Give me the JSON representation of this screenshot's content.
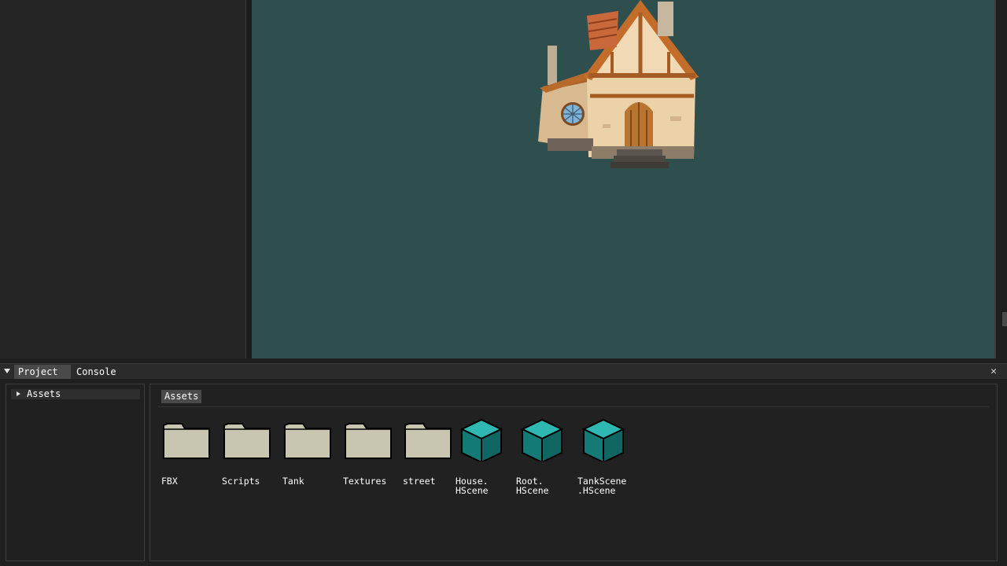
{
  "panel": {
    "tabs": [
      {
        "label": "Project",
        "active": true
      },
      {
        "label": "Console",
        "active": false
      }
    ],
    "close_glyph": "✕"
  },
  "tree": {
    "root_label": "Assets"
  },
  "browser": {
    "breadcrumb": "Assets",
    "items": [
      {
        "label": "FBX",
        "kind": "folder"
      },
      {
        "label": "Scripts",
        "kind": "folder"
      },
      {
        "label": "Tank",
        "kind": "folder"
      },
      {
        "label": "Textures",
        "kind": "folder"
      },
      {
        "label": "street",
        "kind": "folder"
      },
      {
        "label": "House.\nHScene",
        "kind": "scene"
      },
      {
        "label": "Root.\nHScene",
        "kind": "scene"
      },
      {
        "label": "TankScene\n.HScene",
        "kind": "scene"
      }
    ]
  },
  "colors": {
    "viewport_bg": "#2f4f4f",
    "folder": "#c8c5b0",
    "scene_cube": "#1a8f8a"
  }
}
